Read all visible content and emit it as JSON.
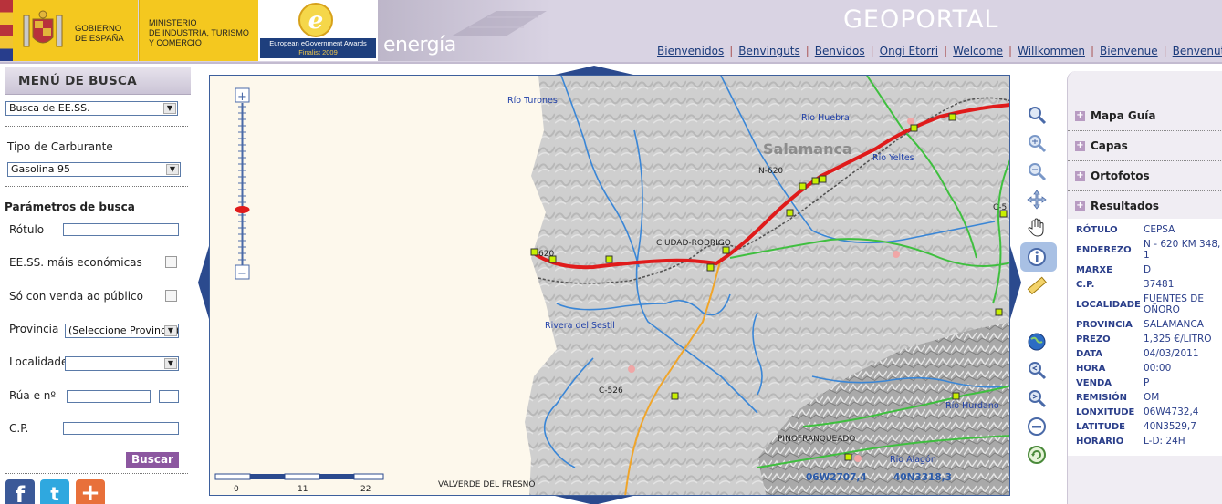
{
  "header": {
    "gov_line1": "GOBIERNO",
    "gov_line2": "DE ESPAÑA",
    "ministry_line1": "MINISTERIO",
    "ministry_line2": "DE INDUSTRIA, TURISMO",
    "ministry_line3": "Y COMERCIO",
    "award_title": "European eGovernment Awards",
    "award_sub": "Finalist 2009",
    "energia": "energía",
    "site_title": "GEOPORTAL",
    "languages": [
      "Bienvenidos",
      "Benvinguts",
      "Benvidos",
      "Ongi Etorri",
      "Welcome",
      "Willkommen",
      "Bienvenue",
      "Benvenuto"
    ]
  },
  "menu": {
    "title": "MENÚ DE BUSCA",
    "search_type": "Busca de EE.SS.",
    "fuel_label": "Tipo de Carburante",
    "fuel_value": "Gasolina 95",
    "params_title": "Parámetros de busca",
    "rotulo_label": "Rótulo",
    "cheapest_label": "EE.SS. máis económicas",
    "public_label": "Só con venda ao público",
    "province_label": "Provincia",
    "province_value": "(Seleccione Provincia)",
    "locality_label": "Localidade",
    "locality_value": "",
    "street_label": "Rúa e nº",
    "cp_label": "C.P.",
    "search_button": "Buscar",
    "social": [
      "f",
      "t",
      "+"
    ]
  },
  "map": {
    "labels": {
      "rio_turones": "Río Turones",
      "rio_huebra": "Río Huebra",
      "salamanca": "Salamanca",
      "n620": "N-620",
      "rio_yeltes": "Río Yeltes",
      "c5_partial": "C-5",
      "ciudad_rodrigo": "CIUDAD-RODRIGO",
      "n620_short": "620",
      "rivera_sestil": "Rivera del Sestil",
      "c526": "C-526",
      "rio_hurdano": "Río Hurdano",
      "pinofranqueado": "PINOFRANQUEADO",
      "rio_alagon": "Río Alagón",
      "valverde": "VALVERDE DEL FRESNO"
    },
    "coords": {
      "lon": "06W2707,4",
      "lat": "40N3318,3"
    },
    "scale_ticks": [
      "0",
      "11",
      "22"
    ]
  },
  "tools": [
    "zoom-all-icon",
    "zoom-in-icon",
    "zoom-out-icon",
    "pan-move-icon",
    "hand-icon",
    "info-icon",
    "measure-ruler-icon",
    "globe-icon",
    "zoom-prev-icon",
    "zoom-next-icon",
    "refresh-icon",
    "reload-icon"
  ],
  "panel": {
    "sections": [
      "Mapa Guía",
      "Capas",
      "Ortofotos",
      "Resultados"
    ],
    "results": [
      {
        "key": "RÓTULO",
        "value": "CEPSA"
      },
      {
        "key": "ENDEREZO",
        "value": "N - 620 KM 348, 1"
      },
      {
        "key": "MARXE",
        "value": "D"
      },
      {
        "key": "C.P.",
        "value": "37481"
      },
      {
        "key": "LOCALIDADE",
        "value": "FUENTES DE OÑORO"
      },
      {
        "key": "PROVINCIA",
        "value": "SALAMANCA"
      },
      {
        "key": "PREZO",
        "value": "1,325 €/LITRO"
      },
      {
        "key": "DATA",
        "value": "04/03/2011"
      },
      {
        "key": "HORA",
        "value": "00:00"
      },
      {
        "key": "VENDA",
        "value": "P"
      },
      {
        "key": "REMISIÓN",
        "value": "OM"
      },
      {
        "key": "LONXITUDE",
        "value": "06W4732,4"
      },
      {
        "key": "LATITUDE",
        "value": "40N3529,7"
      },
      {
        "key": "HORARIO",
        "value": "L-D: 24H"
      }
    ]
  },
  "colors": {
    "header_bg": "#d9d3e3",
    "gov_yellow": "#f4c81f",
    "route_red": "#e01b1b",
    "river_blue": "#3a86d6",
    "road_green": "#3fbf3f",
    "road_orange": "#f0a52a",
    "link_blue": "#1a3a7a"
  }
}
